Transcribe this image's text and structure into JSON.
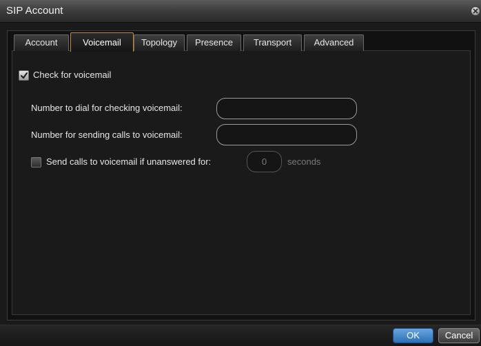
{
  "window": {
    "title": "SIP Account"
  },
  "tabs": [
    {
      "label": "Account",
      "active": false
    },
    {
      "label": "Voicemail",
      "active": true
    },
    {
      "label": "Topology",
      "active": false
    },
    {
      "label": "Presence",
      "active": false
    },
    {
      "label": "Transport",
      "active": false
    },
    {
      "label": "Advanced",
      "active": false
    }
  ],
  "voicemail": {
    "check_label": "Check for voicemail",
    "check_checked": true,
    "dial_label": "Number to dial for checking voicemail:",
    "dial_value": "",
    "send_label": "Number for sending calls to voicemail:",
    "send_value": "",
    "unanswered_label": "Send calls to voicemail if unanswered for:",
    "unanswered_checked": false,
    "unanswered_value": "0",
    "seconds_label": "seconds"
  },
  "buttons": {
    "ok": "OK",
    "cancel": "Cancel"
  },
  "colors": {
    "accent_tab": "#c58a2b",
    "ok_button": "#2c6fb6"
  }
}
